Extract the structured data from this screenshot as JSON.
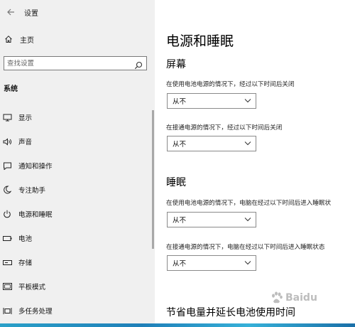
{
  "window": {
    "title": "设置"
  },
  "sidebar": {
    "home_label": "主页",
    "search_placeholder": "查找设置",
    "section_title": "系统",
    "items": [
      {
        "label": "显示",
        "icon": "display-icon"
      },
      {
        "label": "声音",
        "icon": "speaker-icon"
      },
      {
        "label": "通知和操作",
        "icon": "notification-icon"
      },
      {
        "label": "专注助手",
        "icon": "moon-icon"
      },
      {
        "label": "电源和睡眠",
        "icon": "power-icon"
      },
      {
        "label": "电池",
        "icon": "battery-icon"
      },
      {
        "label": "存储",
        "icon": "storage-icon"
      },
      {
        "label": "平板模式",
        "icon": "tablet-icon"
      },
      {
        "label": "多任务处理",
        "icon": "multitask-icon"
      }
    ]
  },
  "main": {
    "title": "电源和睡眠",
    "screen": {
      "heading": "屏幕",
      "battery_desc": "在使用电池电源的情况下，经过以下时间后关闭",
      "battery_value": "从不",
      "plugged_desc": "在接通电源的情况下，经过以下时间后关闭",
      "plugged_value": "从不"
    },
    "sleep": {
      "heading": "睡眠",
      "battery_desc": "在使用电池电源的情况下，电脑在经过以下时间后进入睡眠状",
      "battery_value": "从不",
      "plugged_desc": "在接通电源的情况下，电脑在经过以下时间后进入睡眠状态",
      "plugged_value": "从不"
    },
    "bottom_heading": "节省电量并延长电池使用时间"
  },
  "watermark": {
    "text": "Baidu"
  },
  "colors": {
    "sidebar_bg": "#f0f0f0",
    "main_bg": "#ffffff",
    "dropdown_border": "#8a8a8a"
  }
}
